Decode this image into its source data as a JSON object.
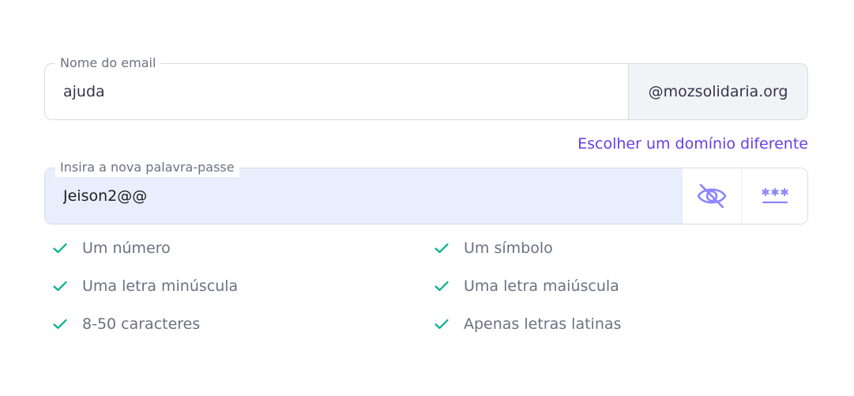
{
  "email_field": {
    "label": "Nome do email",
    "value": "ajuda",
    "domain": "@mozsolidaria.org"
  },
  "change_domain_link": "Escolher um domínio diferente",
  "password_field": {
    "label": "Insira a nova palavra-passe",
    "value": "Jeison2@@",
    "toggle_icon": "eye-off-icon",
    "generate_icon": "password-generate-icon"
  },
  "requirements": [
    {
      "label": "Um número",
      "met": true
    },
    {
      "label": "Um símbolo",
      "met": true
    },
    {
      "label": "Uma letra minúscula",
      "met": true
    },
    {
      "label": "Uma letra maiúscula",
      "met": true
    },
    {
      "label": "8-50 caracteres",
      "met": true
    },
    {
      "label": "Apenas letras latinas",
      "met": true
    }
  ],
  "colors": {
    "accent": "#673de6",
    "check": "#00b090",
    "icon": "#8c85ff",
    "text_muted": "#6d7081",
    "autofill_bg": "#e8eefc"
  }
}
